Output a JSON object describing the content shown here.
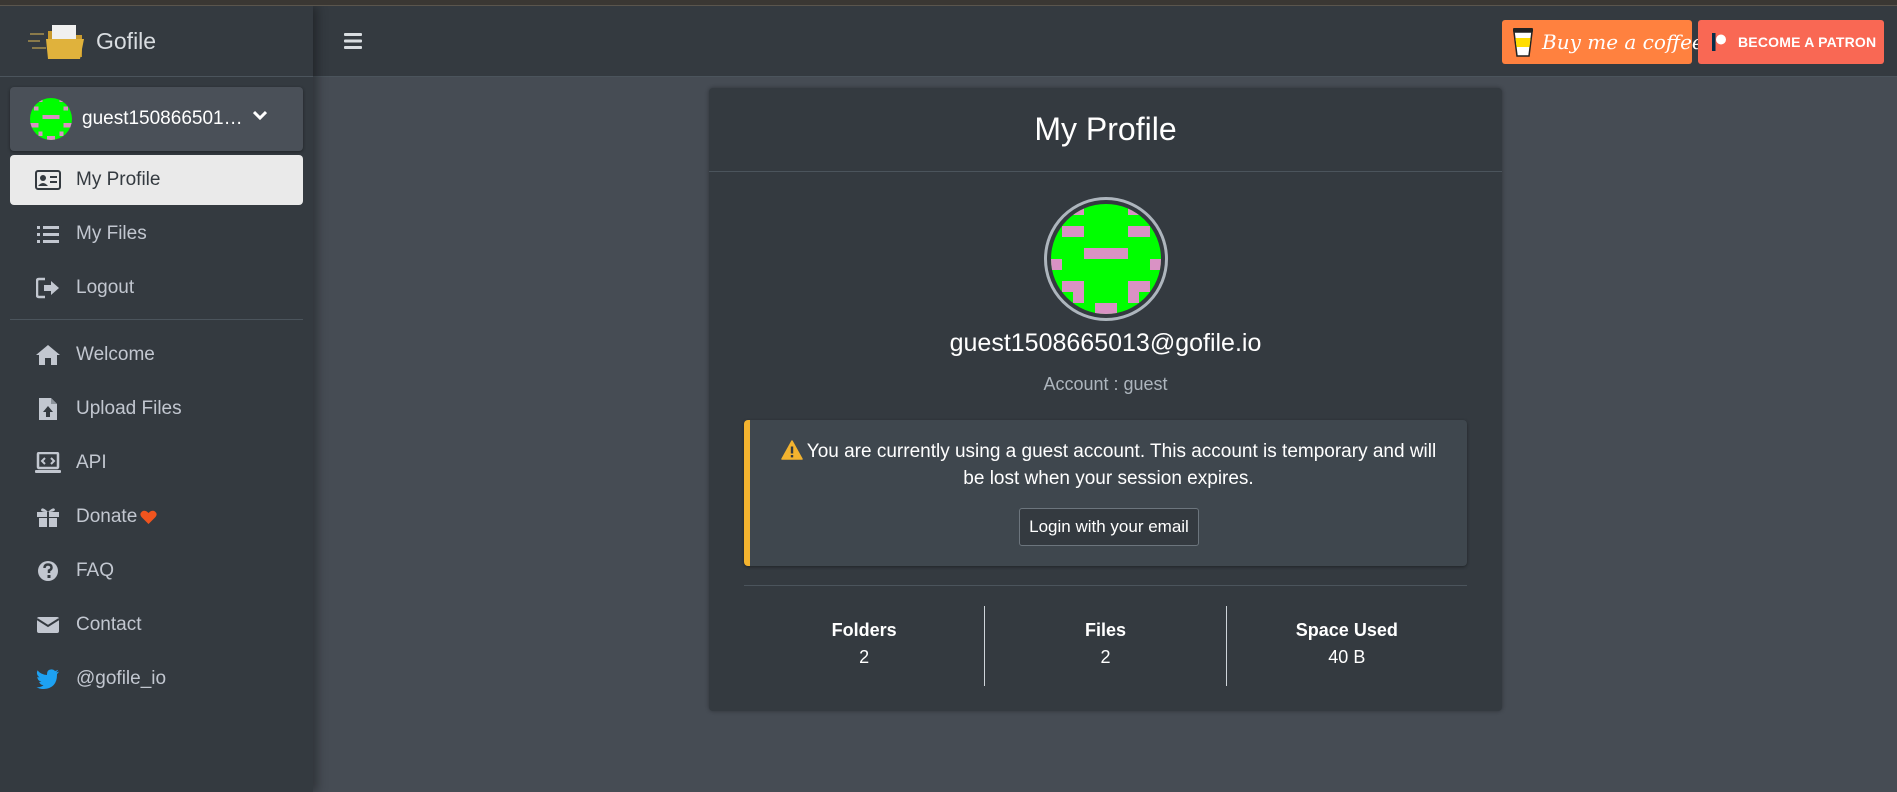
{
  "brand": {
    "name": "Gofile"
  },
  "user_panel": {
    "username": "guest150866501…",
    "icon": "chevron-down-icon"
  },
  "sidebar": {
    "items": [
      {
        "label": "My Profile",
        "icon": "id-card-icon",
        "active": true
      },
      {
        "label": "My Files",
        "icon": "list-icon"
      },
      {
        "label": "Logout",
        "icon": "logout-icon"
      },
      {
        "label": "Welcome",
        "icon": "home-icon"
      },
      {
        "label": "Upload Files",
        "icon": "file-upload-icon"
      },
      {
        "label": "API",
        "icon": "laptop-code-icon"
      },
      {
        "label": "Donate",
        "icon": "gift-icon",
        "badge_icon": "heart-icon"
      },
      {
        "label": "FAQ",
        "icon": "question-circle-icon"
      },
      {
        "label": "Contact",
        "icon": "envelope-icon"
      },
      {
        "label": "@gofile_io",
        "icon": "twitter-icon"
      }
    ]
  },
  "header": {
    "menu_icon": "hamburger-icon",
    "bmc_label": "Buy me a coffee",
    "patron_label": "BECOME A PATRON"
  },
  "profile": {
    "title": "My Profile",
    "email": "guest1508665013@gofile.io",
    "account": "Account : guest",
    "callout": {
      "icon": "warning-icon",
      "text": "You are currently using a guest account. This account is temporary and will be lost when your session expires.",
      "button_label": "Login with your email"
    },
    "stats": [
      {
        "label": "Folders",
        "value": "2"
      },
      {
        "label": "Files",
        "value": "2"
      },
      {
        "label": "Space Used",
        "value": "40 B"
      }
    ]
  },
  "colors": {
    "background": "#464c54",
    "sidebar": "#343a40",
    "accent_warning": "#f3b32f",
    "bmc": "#ff813f",
    "patron": "#f96854",
    "avatar_green": "#00ff00",
    "avatar_pink": "#d992c4",
    "heart": "#f0541e",
    "twitter": "#1da1f2"
  }
}
